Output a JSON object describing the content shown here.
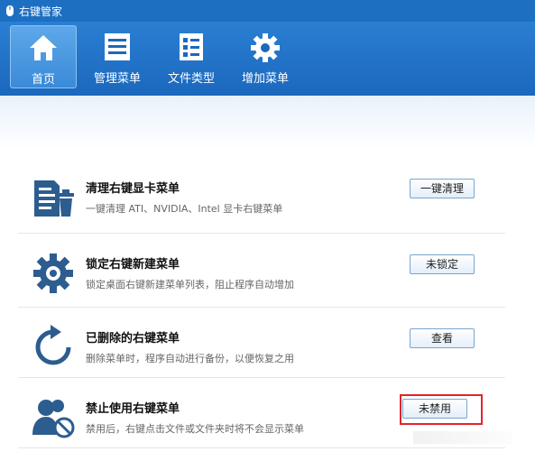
{
  "window": {
    "title": "右键管家"
  },
  "toolbar": {
    "items": [
      {
        "label": "首页",
        "icon": "home-icon",
        "active": true
      },
      {
        "label": "管理菜单",
        "icon": "menu-list-icon",
        "active": false
      },
      {
        "label": "文件类型",
        "icon": "file-types-icon",
        "active": false
      },
      {
        "label": "增加菜单",
        "icon": "gear-icon",
        "active": false
      }
    ]
  },
  "features": [
    {
      "title": "清理右键显卡菜单",
      "desc": "一键清理 ATI、NVIDIA、Intel 显卡右键菜单",
      "button": "一键清理",
      "icon": "clean-document-trash-icon"
    },
    {
      "title": "锁定右键新建菜单",
      "desc": "锁定桌面右键新建菜单列表，阻止程序自动增加",
      "button": "未锁定",
      "icon": "gear-icon"
    },
    {
      "title": "已删除的右键菜单",
      "desc": "删除菜单时，程序自动进行备份，以便恢复之用",
      "button": "查看",
      "icon": "refresh-icon"
    },
    {
      "title": "禁止使用右键菜单",
      "desc": "禁用后，右键点击文件或文件夹时将不会显示菜单",
      "button": "未禁用",
      "icon": "users-block-icon"
    }
  ],
  "colors": {
    "title_bar": "#1d6fc2",
    "icon_blue": "#2d5d8f",
    "highlight": "#e0262a"
  }
}
